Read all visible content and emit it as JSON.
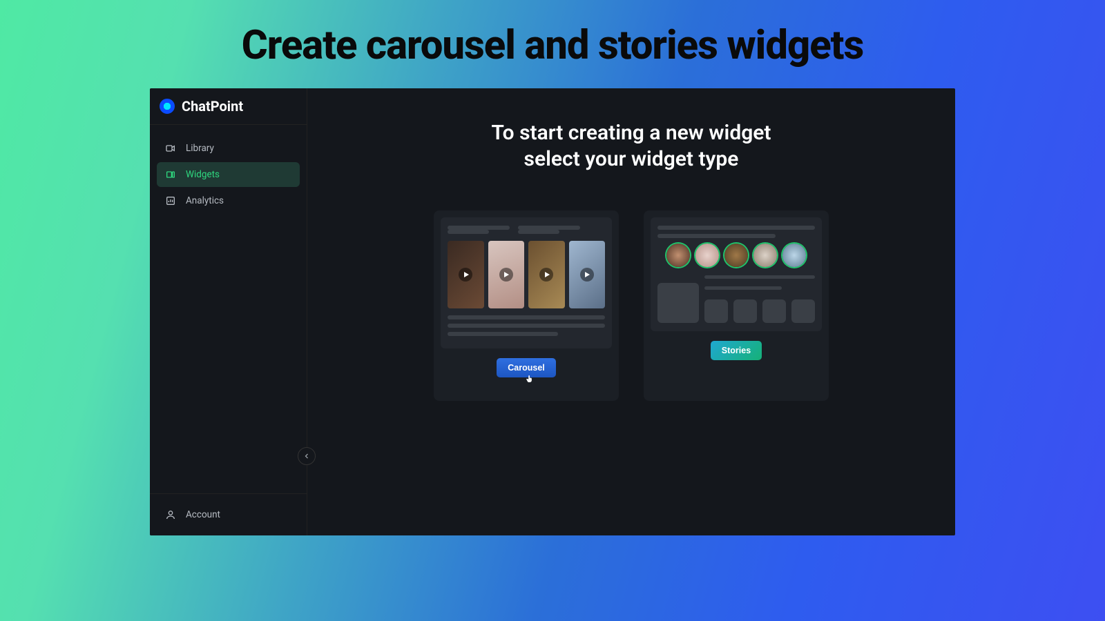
{
  "hero_title": "Create carousel and stories widgets",
  "brand": {
    "name": "ChatPoint"
  },
  "sidebar": {
    "items": [
      {
        "label": "Library"
      },
      {
        "label": "Widgets"
      },
      {
        "label": "Analytics"
      }
    ],
    "account_label": "Account"
  },
  "main": {
    "headline_line1": "To start creating a new widget",
    "headline_line2": "select your widget type",
    "carousel_button": "Carousel",
    "stories_button": "Stories"
  }
}
